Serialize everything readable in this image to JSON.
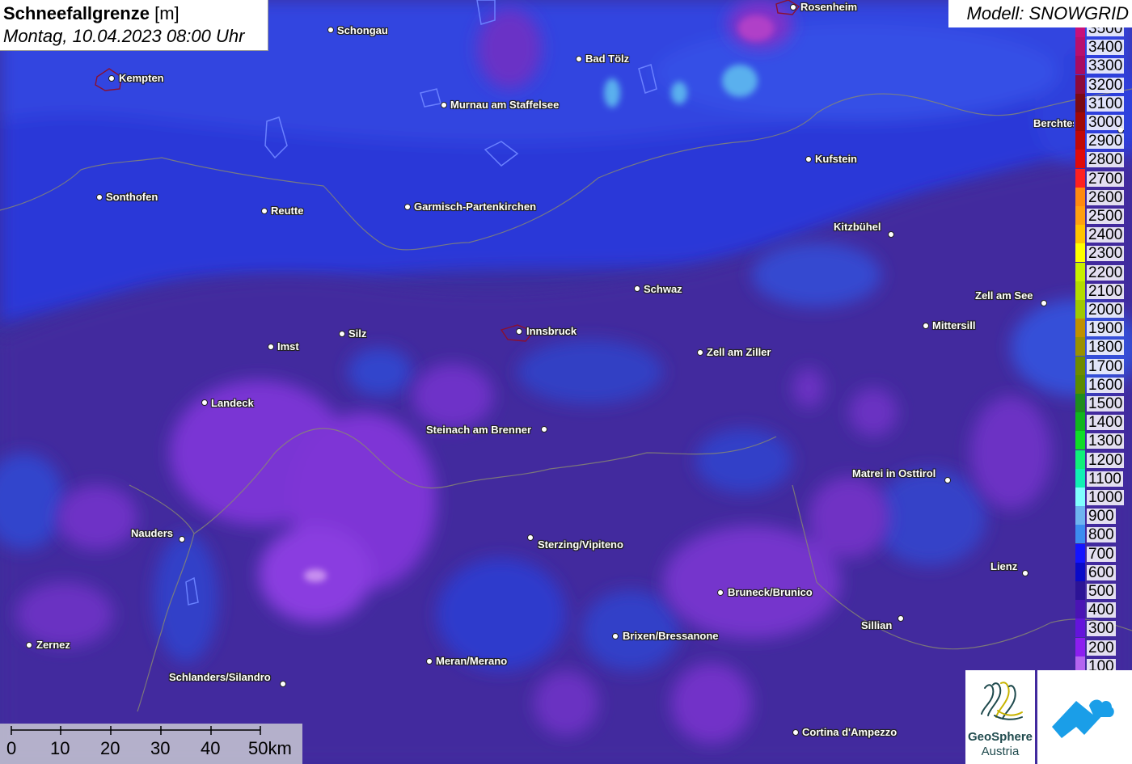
{
  "title": {
    "name": "Schneefallgrenze",
    "unit": "[m]",
    "datetime": "Montag, 10.04.2023 08:00 Uhr"
  },
  "model": "Modell: SNOWGRID",
  "cities": [
    {
      "name": "Rosenheim",
      "label_side": "right"
    },
    {
      "name": "Schongau",
      "label_side": "right"
    },
    {
      "name": "Bad Tölz",
      "label_side": "right"
    },
    {
      "name": "Kempten",
      "label_side": "right"
    },
    {
      "name": "Murnau am Staffelsee",
      "label_side": "right"
    },
    {
      "name": "Berchtesgaden",
      "label_side": "left"
    },
    {
      "name": "Kufstein",
      "label_side": "right"
    },
    {
      "name": "Sonthofen",
      "label_side": "right"
    },
    {
      "name": "Reutte",
      "label_side": "right"
    },
    {
      "name": "Garmisch-Partenkirchen",
      "label_side": "right"
    },
    {
      "name": "Kitzbühel",
      "label_side": "left"
    },
    {
      "name": "Schwaz",
      "label_side": "right"
    },
    {
      "name": "Zell am See",
      "label_side": "left"
    },
    {
      "name": "Mittersill",
      "label_side": "right"
    },
    {
      "name": "Innsbruck",
      "label_side": "right"
    },
    {
      "name": "Silz",
      "label_side": "right"
    },
    {
      "name": "Imst",
      "label_side": "right"
    },
    {
      "name": "Zell am Ziller",
      "label_side": "right"
    },
    {
      "name": "Landeck",
      "label_side": "right"
    },
    {
      "name": "Steinach am Brenner",
      "label_side": "left"
    },
    {
      "name": "Matrei in Osttirol",
      "label_side": "left"
    },
    {
      "name": "Nauders",
      "label_side": "left"
    },
    {
      "name": "Sterzing/Vipiteno",
      "label_side": "right"
    },
    {
      "name": "Lienz",
      "label_side": "left"
    },
    {
      "name": "Bruneck/Brunico",
      "label_side": "right"
    },
    {
      "name": "Brixen/Bressanone",
      "label_side": "right"
    },
    {
      "name": "Sillian",
      "label_side": "left"
    },
    {
      "name": "Zernez",
      "label_side": "right"
    },
    {
      "name": "Meran/Merano",
      "label_side": "right"
    },
    {
      "name": "Schlanders/Silandro",
      "label_side": "left"
    },
    {
      "name": "Cortina d'Ampezzo",
      "label_side": "right"
    }
  ],
  "legend": [
    {
      "label": "3500",
      "color": "#c8107a"
    },
    {
      "label": "3400",
      "color": "#b8106e"
    },
    {
      "label": "3300",
      "color": "#a80c62"
    },
    {
      "label": "3200",
      "color": "#8c0a3c"
    },
    {
      "label": "3100",
      "color": "#7a0a14"
    },
    {
      "label": "3000",
      "color": "#a00808"
    },
    {
      "label": "2900",
      "color": "#c00808"
    },
    {
      "label": "2800",
      "color": "#e00a0a"
    },
    {
      "label": "2700",
      "color": "#ff2020"
    },
    {
      "label": "2600",
      "color": "#ff8a10"
    },
    {
      "label": "2500",
      "color": "#ffa010"
    },
    {
      "label": "2400",
      "color": "#ffc400"
    },
    {
      "label": "2300",
      "color": "#ffff00"
    },
    {
      "label": "2200",
      "color": "#c8f000"
    },
    {
      "label": "2100",
      "color": "#b4dc00"
    },
    {
      "label": "2000",
      "color": "#a0c800"
    },
    {
      "label": "1900",
      "color": "#c09000"
    },
    {
      "label": "1800",
      "color": "#9a9000"
    },
    {
      "label": "1700",
      "color": "#6e8a00"
    },
    {
      "label": "1600",
      "color": "#5a8a00"
    },
    {
      "label": "1500",
      "color": "#1e8c1e"
    },
    {
      "label": "1400",
      "color": "#10b41e"
    },
    {
      "label": "1300",
      "color": "#10dc28"
    },
    {
      "label": "1200",
      "color": "#10f07a"
    },
    {
      "label": "1100",
      "color": "#10f0b4"
    },
    {
      "label": "1000",
      "color": "#80ffff"
    },
    {
      "label": "900",
      "color": "#6eb4f0"
    },
    {
      "label": "800",
      "color": "#3c8cf0"
    },
    {
      "label": "700",
      "color": "#1414ff"
    },
    {
      "label": "600",
      "color": "#0a0ac8"
    },
    {
      "label": "500",
      "color": "#2c1496"
    },
    {
      "label": "400",
      "color": "#4a14b4"
    },
    {
      "label": "300",
      "color": "#6414dc"
    },
    {
      "label": "200",
      "color": "#8c1ef0"
    },
    {
      "label": "100",
      "color": "#b464f0"
    }
  ],
  "scale": {
    "labels": [
      "0",
      "10",
      "20",
      "30",
      "40",
      "50km"
    ]
  },
  "logo": {
    "line1": "GeoSphere",
    "line2": "Austria"
  },
  "colors": {
    "map_base": "#3a2f9a",
    "low_snowline": "#2d3bd6",
    "mid_snowline": "#4a2aa0",
    "high_snowline": "#7a30d0",
    "logo_blue": "#1a9ee8"
  }
}
